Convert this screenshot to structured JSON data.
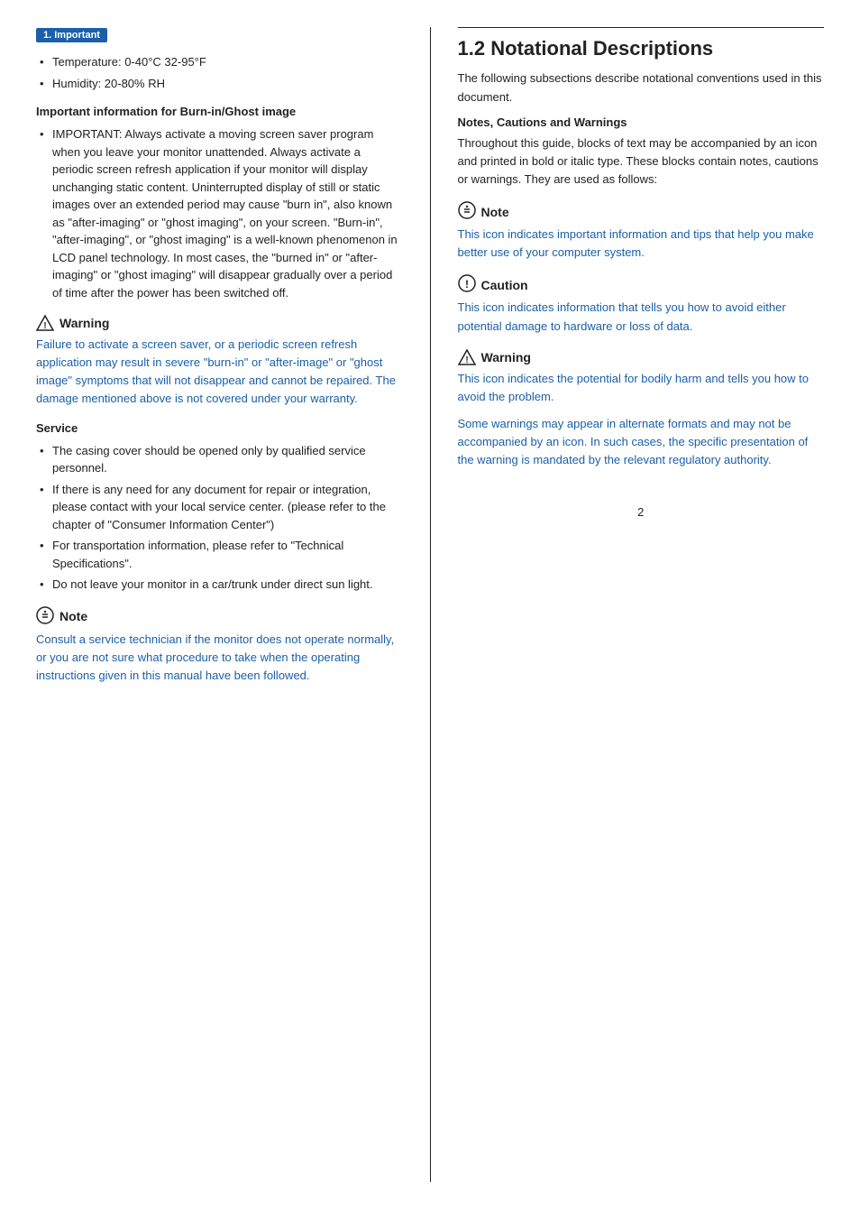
{
  "tab": "1. Important",
  "left": {
    "bullets_top": [
      "Temperature: 0-40°C 32-95°F",
      "Humidity: 20-80% RH"
    ],
    "burn_heading": "Important information for Burn-in/Ghost image",
    "burn_text": "IMPORTANT: Always activate a moving screen saver program when you leave your monitor unattended. Always activate a periodic screen refresh application if your monitor will display unchanging static content. Uninterrupted display of still or static images over an extended period may cause \"burn in\", also known as \"after-imaging\" or \"ghost imaging\", on your screen. \"Burn-in\", \"after-imaging\", or \"ghost imaging\" is a well-known phenomenon in LCD panel technology. In most cases, the \"burned in\" or \"after-imaging\" or \"ghost imaging\" will disappear gradually over a period of time after the power has been switched off.",
    "warning1_title": "Warning",
    "warning1_body": "Failure to activate a screen saver, or a periodic screen refresh application may result in severe \"burn-in\" or \"after-image\" or \"ghost image\" symptoms that will not disappear and cannot be repaired. The damage mentioned above is not covered under your warranty.",
    "service_heading": "Service",
    "service_bullets": [
      "The casing cover should be opened only by qualified service personnel.",
      "If there is any need for any document for repair or integration, please contact with your local service center. (please refer to the chapter of \"Consumer Information Center\")",
      "For transportation information, please refer to \"Technical Specifications\".",
      "Do not leave your monitor in a car/trunk under direct sun light."
    ],
    "note_title": "Note",
    "note_body": "Consult a service technician if the monitor does not operate normally, or you are not sure what procedure to take when the operating instructions given in this manual have been followed."
  },
  "right": {
    "section_number": "1.2",
    "section_title": "Notational Descriptions",
    "intro": "The following subsections describe notational conventions used in this document.",
    "notes_heading": "Notes, Cautions and Warnings",
    "notes_intro": "Throughout this guide, blocks of text may be accompanied by an icon and printed in bold or italic type. These blocks contain notes, cautions or warnings. They are used as follows:",
    "note_title": "Note",
    "note_body": "This icon indicates important information and tips that help you make better use of your computer system.",
    "caution_title": "Caution",
    "caution_body": "This icon indicates information that tells you how to avoid either potential damage to hardware or loss of data.",
    "warning_title": "Warning",
    "warning_body1": "This icon indicates the potential for bodily harm and tells you how to avoid the problem.",
    "warning_body2": "Some warnings may appear in alternate formats and may not be accompanied by an icon. In such cases, the specific presentation of the warning is mandated by the relevant regulatory authority."
  },
  "page_number": "2"
}
